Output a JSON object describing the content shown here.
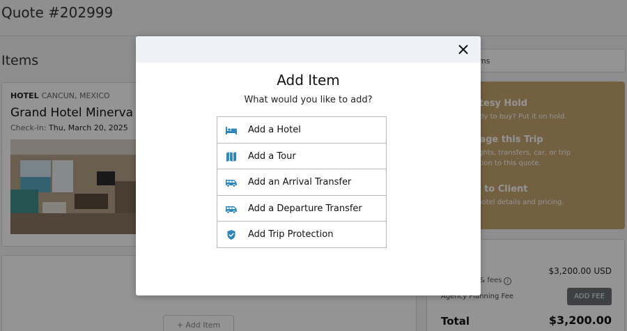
{
  "page": {
    "quote_title": "Quote #202999",
    "items_title": "Items",
    "hotel": {
      "type": "HOTEL",
      "location": "CANCUN, MEXICO",
      "name": "Grand Hotel Minerva",
      "checkin_label": "Check-in:",
      "checkin_date": "Thu, March 20, 2025"
    },
    "add_item_label": "+ Add Item",
    "right_bar_label": "ms",
    "actions": [
      {
        "title": "urtesy Hold",
        "desc": "ready to buy? Put it on hold."
      },
      {
        "title": "ckage this Trip",
        "desc": "l flights, transfers, car, or trip\ntection to this quote."
      },
      {
        "title": "nd to Client",
        "desc": "re hotel details and pricing."
      }
    ],
    "summary": {
      "amount": "$3,200.00 USD",
      "taxes_label": "s & fees",
      "fee_label": "Agency Planning Fee",
      "add_fee_label": "ADD FEE",
      "total_label": "Total",
      "total_value": "$3,200.00"
    }
  },
  "modal": {
    "title": "Add Item",
    "subtitle": "What would you like to add?",
    "options": [
      {
        "label": "Add a Hotel",
        "icon": "bed-icon"
      },
      {
        "label": "Add a Tour",
        "icon": "map-icon"
      },
      {
        "label": "Add an Arrival Transfer",
        "icon": "van-icon"
      },
      {
        "label": "Add a Departure Transfer",
        "icon": "van-icon"
      },
      {
        "label": "Add Trip Protection",
        "icon": "shield-check-icon"
      }
    ]
  },
  "colors": {
    "icon_accent": "#2e86b8",
    "actions_panel": "#c7a56f",
    "modal_header": "#eef2f6"
  }
}
